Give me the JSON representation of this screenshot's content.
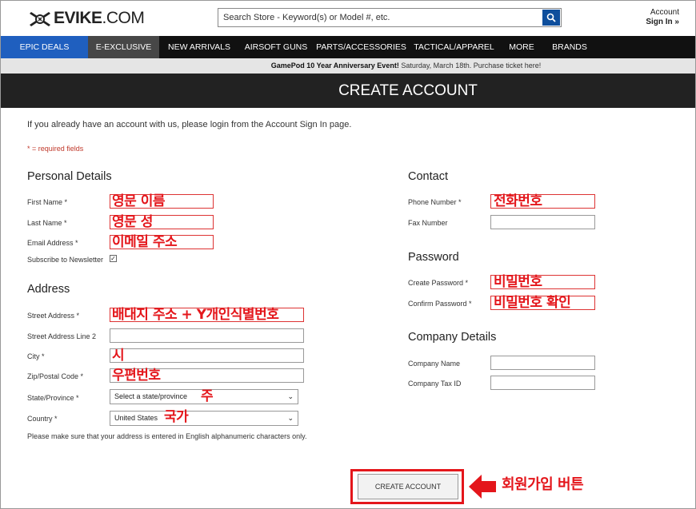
{
  "header": {
    "logo_text": "EVIKE",
    "logo_suffix": ".COM",
    "search_placeholder": "Search Store - Keyword(s) or Model #, etc.",
    "account_label": "Account",
    "signin_label": "Sign In »"
  },
  "nav": {
    "items": [
      "EPIC DEALS",
      "E-EXCLUSIVE",
      "NEW ARRIVALS",
      "AIRSOFT GUNS",
      "PARTS/ACCESSORIES",
      "TACTICAL/APPAREL",
      "MORE",
      "BRANDS"
    ]
  },
  "promo": {
    "bold": "GamePod 10 Year Anniversary Event!",
    "text": " Saturday, March 18th. Purchase ticket here!"
  },
  "page": {
    "title": "CREATE ACCOUNT",
    "intro": "If you already have an account with us, please login from the Account Sign In page.",
    "required_note": "* = required fields"
  },
  "personal": {
    "heading": "Personal Details",
    "first_name": "First Name *",
    "last_name": "Last Name *",
    "email": "Email Address *",
    "newsletter": "Subscribe to Newsletter",
    "newsletter_check": "✓"
  },
  "address": {
    "heading": "Address",
    "street": "Street Address *",
    "street2": "Street Address Line 2",
    "city": "City *",
    "zip": "Zip/Postal Code *",
    "state": "State/Province *",
    "state_value": "Select a state/province",
    "country": "Country *",
    "country_value": "United States",
    "note": "Please make sure that your address is entered in English alphanumeric characters only."
  },
  "contact": {
    "heading": "Contact",
    "phone": "Phone Number *",
    "fax": "Fax Number"
  },
  "password": {
    "heading": "Password",
    "create": "Create Password *",
    "confirm": "Confirm Password *"
  },
  "company": {
    "heading": "Company Details",
    "name": "Company Name",
    "tax": "Company Tax ID"
  },
  "submit": {
    "label": "CREATE ACCOUNT"
  },
  "annotations": {
    "first_name": "영문 이름",
    "last_name": "영문 성",
    "email": "이메일 주소",
    "street": "배대지 주소 + Y개인식별번호",
    "city": "시",
    "zip": "우편번호",
    "state": "주",
    "country": "국가",
    "phone": "전화번호",
    "create_password": "비밀번호",
    "confirm_password": "비밀번호 확인",
    "submit": "회원가입 버튼"
  },
  "colors": {
    "nav_bg": "#111111",
    "epic_deals": "#1f5fbf",
    "title_bg": "#222222",
    "annotation": "#e4161b",
    "search_btn": "#0e4e9c"
  }
}
